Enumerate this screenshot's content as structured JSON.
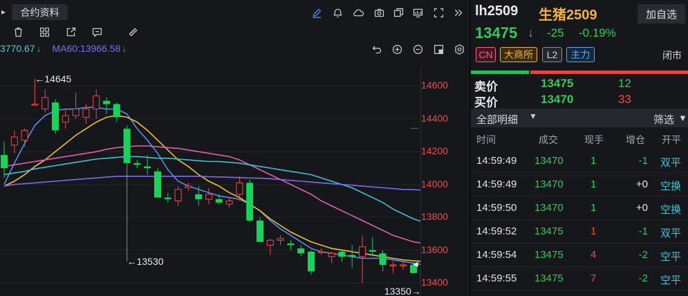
{
  "chart": {
    "contract_button": "合约资料",
    "ma_legend": {
      "ma30_text": "3770.67",
      "ma30_arrow": "↓",
      "ma60_text": "MA60:13966.58",
      "ma60_arrow": "↓"
    },
    "price_axis_labels": [
      "14600",
      "14400",
      "14200",
      "14000",
      "13800",
      "13600",
      "13400"
    ],
    "annotations": {
      "high": "←14645",
      "low_left": "←13530",
      "low_right": "13350→"
    }
  },
  "chart_data": {
    "type": "candlestick",
    "ylim": [
      13320,
      14720
    ],
    "candles": [
      {
        "o": 14180,
        "h": 14260,
        "l": 14040,
        "c": 14100
      },
      {
        "o": 14240,
        "h": 14330,
        "l": 14190,
        "c": 14290
      },
      {
        "o": 14270,
        "h": 14340,
        "l": 14230,
        "c": 14330
      },
      {
        "o": 14490,
        "h": 14645,
        "l": 14480,
        "c": 14490
      },
      {
        "o": 14460,
        "h": 14580,
        "l": 14440,
        "c": 14530
      },
      {
        "o": 14500,
        "h": 14520,
        "l": 14310,
        "c": 14330
      },
      {
        "o": 14380,
        "h": 14460,
        "l": 14340,
        "c": 14420
      },
      {
        "o": 14420,
        "h": 14560,
        "l": 14400,
        "c": 14460
      },
      {
        "o": 14410,
        "h": 14490,
        "l": 14370,
        "c": 14460
      },
      {
        "o": 14460,
        "h": 14580,
        "l": 14400,
        "c": 14540
      },
      {
        "o": 14510,
        "h": 14530,
        "l": 14430,
        "c": 14490
      },
      {
        "o": 14490,
        "h": 14500,
        "l": 14380,
        "c": 14410
      },
      {
        "o": 14340,
        "h": 14360,
        "l": 13530,
        "c": 14130
      },
      {
        "o": 14130,
        "h": 14150,
        "l": 14100,
        "c": 14120
      },
      {
        "o": 14110,
        "h": 14180,
        "l": 14060,
        "c": 14100
      },
      {
        "o": 14080,
        "h": 14100,
        "l": 13950,
        "c": 13920
      },
      {
        "o": 13920,
        "h": 13950,
        "l": 13890,
        "c": 13910
      },
      {
        "o": 13900,
        "h": 13990,
        "l": 13870,
        "c": 13970
      },
      {
        "o": 13980,
        "h": 14010,
        "l": 13960,
        "c": 13990
      },
      {
        "o": 13940,
        "h": 13990,
        "l": 13870,
        "c": 13910
      },
      {
        "o": 13910,
        "h": 13980,
        "l": 13880,
        "c": 13940
      },
      {
        "o": 13910,
        "h": 13940,
        "l": 13880,
        "c": 13890
      },
      {
        "o": 13880,
        "h": 13920,
        "l": 13860,
        "c": 13900
      },
      {
        "o": 13940,
        "h": 14050,
        "l": 13900,
        "c": 14010
      },
      {
        "o": 14010,
        "h": 14030,
        "l": 13770,
        "c": 13780
      },
      {
        "o": 13780,
        "h": 13800,
        "l": 13650,
        "c": 13650
      },
      {
        "o": 13630,
        "h": 13670,
        "l": 13570,
        "c": 13660
      },
      {
        "o": 13660,
        "h": 13690,
        "l": 13630,
        "c": 13670
      },
      {
        "o": 13640,
        "h": 13660,
        "l": 13600,
        "c": 13630
      },
      {
        "o": 13610,
        "h": 13630,
        "l": 13560,
        "c": 13580
      },
      {
        "o": 13590,
        "h": 13600,
        "l": 13450,
        "c": 13470
      },
      {
        "o": 13590,
        "h": 13610,
        "l": 13570,
        "c": 13590
      },
      {
        "o": 13560,
        "h": 13590,
        "l": 13520,
        "c": 13580
      },
      {
        "o": 13590,
        "h": 13600,
        "l": 13530,
        "c": 13560
      },
      {
        "o": 13570,
        "h": 13630,
        "l": 13490,
        "c": 13560
      },
      {
        "o": 13560,
        "h": 13690,
        "l": 13400,
        "c": 13620
      },
      {
        "o": 13600,
        "h": 13680,
        "l": 13560,
        "c": 13590
      },
      {
        "o": 13580,
        "h": 13600,
        "l": 13470,
        "c": 13510
      },
      {
        "o": 13510,
        "h": 13530,
        "l": 13460,
        "c": 13510
      },
      {
        "o": 13510,
        "h": 13540,
        "l": 13480,
        "c": 13510
      },
      {
        "o": 13510,
        "h": 13540,
        "l": 13460,
        "c": 13460
      },
      {
        "o": 13420,
        "h": 13510,
        "l": 13350,
        "c": 13475
      }
    ],
    "series": [
      {
        "color": "#5a8cf0",
        "values": [
          14000,
          14130,
          14250,
          14360,
          14420,
          14450,
          14460,
          14460,
          14470,
          14470,
          14460,
          14460,
          14430,
          14340,
          14270,
          14190,
          14090,
          14020,
          13990,
          13970,
          13950,
          13930,
          13920,
          13910,
          13880,
          13840,
          13780,
          13730,
          13690,
          13650,
          13610,
          13590,
          13580,
          13570,
          13560,
          13550,
          13550,
          13550,
          13540,
          13530,
          13520,
          13510
        ]
      },
      {
        "color": "#f0c030",
        "values": [
          13990,
          14020,
          14060,
          14110,
          14150,
          14200,
          14250,
          14300,
          14340,
          14380,
          14410,
          14420,
          14410,
          14380,
          14330,
          14270,
          14210,
          14150,
          14110,
          14060,
          14020,
          13990,
          13950,
          13920,
          13880,
          13840,
          13790,
          13750,
          13710,
          13680,
          13650,
          13630,
          13610,
          13600,
          13590,
          13580,
          13570,
          13560,
          13550,
          13540,
          13535,
          13530
        ]
      },
      {
        "color": "#e060b0",
        "values": [
          14110,
          14120,
          14130,
          14140,
          14150,
          14160,
          14170,
          14180,
          14190,
          14200,
          14215,
          14225,
          14230,
          14235,
          14235,
          14230,
          14225,
          14220,
          14210,
          14200,
          14190,
          14180,
          14170,
          14150,
          14120,
          14090,
          14060,
          14030,
          14000,
          13970,
          13940,
          13900,
          13870,
          13840,
          13810,
          13780,
          13750,
          13720,
          13690,
          13670,
          13650,
          13640
        ]
      },
      {
        "color": "#40c0d8",
        "values": [
          14060,
          14070,
          14080,
          14095,
          14105,
          14115,
          14125,
          14135,
          14145,
          14155,
          14160,
          14165,
          14170,
          14170,
          14165,
          14160,
          14160,
          14155,
          14150,
          14145,
          14140,
          14140,
          14135,
          14130,
          14120,
          14110,
          14100,
          14090,
          14080,
          14070,
          14060,
          14040,
          14020,
          14000,
          13980,
          13950,
          13920,
          13890,
          13850,
          13820,
          13790,
          13770
        ]
      },
      {
        "color": "#7d6cf3",
        "values": [
          13990,
          14000,
          14005,
          14010,
          14015,
          14020,
          14025,
          14030,
          14035,
          14040,
          14045,
          14050,
          14050,
          14050,
          14050,
          14050,
          14050,
          14050,
          14050,
          14050,
          14048,
          14046,
          14044,
          14042,
          14040,
          14038,
          14035,
          14030,
          14025,
          14020,
          14015,
          14010,
          14005,
          14000,
          13995,
          13990,
          13985,
          13980,
          13975,
          13970,
          13968,
          13966
        ]
      }
    ]
  },
  "quote": {
    "code": "lh2509",
    "name": "生猪2509",
    "add_watch": "加自选",
    "last_price": "13475",
    "arrow": "↓",
    "change": "-25",
    "change_pct": "-0.19%",
    "tags": {
      "cn": "CN",
      "exchange": "大商所",
      "level": "L2",
      "main": "主力"
    },
    "status": "闭市",
    "sell": {
      "label": "卖价",
      "price": "13475",
      "volume": "12"
    },
    "buy": {
      "label": "买价",
      "price": "13470",
      "volume": "33"
    },
    "detail_title": "全部明细",
    "filter": "筛选",
    "columns": [
      "时间",
      "成交",
      "现手",
      "增仓",
      "开平"
    ],
    "trades": [
      {
        "time": "14:59:49",
        "price": "13470",
        "vol": "1",
        "vol_color": "green",
        "inc": "-1",
        "inc_color": "green",
        "type": "双平"
      },
      {
        "time": "14:59:49",
        "price": "13470",
        "vol": "1",
        "vol_color": "green",
        "inc": "+0",
        "inc_color": "white",
        "type": "空换"
      },
      {
        "time": "14:59:50",
        "price": "13470",
        "vol": "1",
        "vol_color": "green",
        "inc": "+0",
        "inc_color": "white",
        "type": "空换"
      },
      {
        "time": "14:59:52",
        "price": "13475",
        "vol": "1",
        "vol_color": "red",
        "inc": "-1",
        "inc_color": "green",
        "type": "双平"
      },
      {
        "time": "14:59:54",
        "price": "13475",
        "vol": "4",
        "vol_color": "red",
        "inc": "-2",
        "inc_color": "green",
        "type": "空平"
      },
      {
        "time": "14:59:55",
        "price": "13475",
        "vol": "7",
        "vol_color": "red",
        "inc": "-2",
        "inc_color": "green",
        "type": "空平"
      }
    ]
  }
}
